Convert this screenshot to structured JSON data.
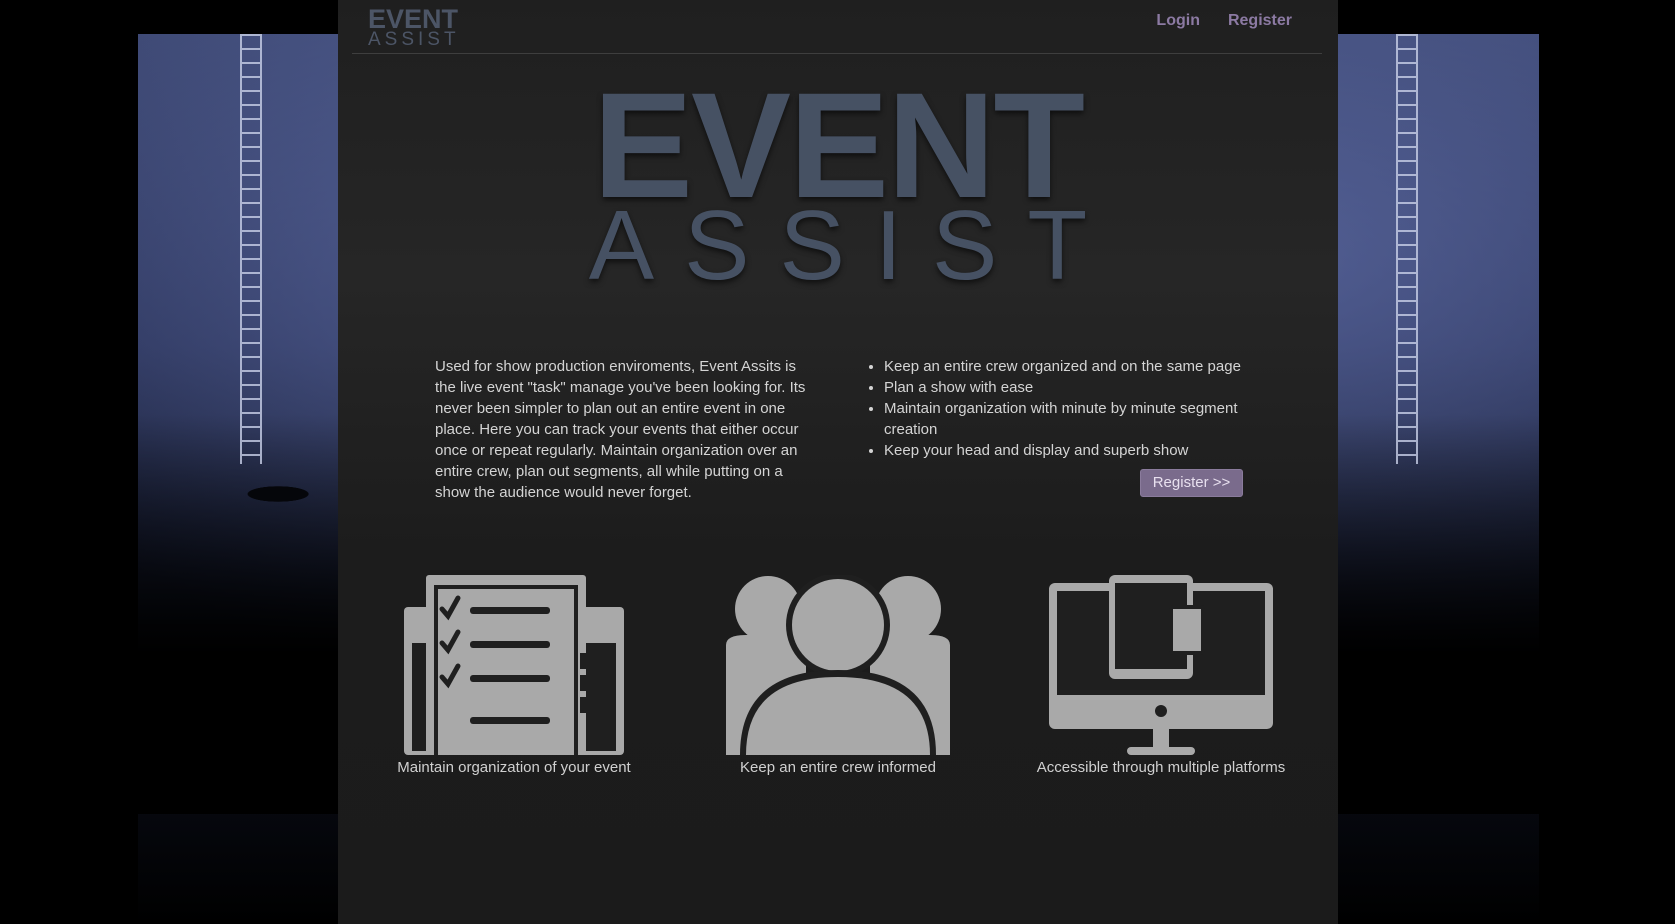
{
  "nav": {
    "logo_top": "EVENT",
    "logo_bottom": "ASSIST",
    "login": "Login",
    "register": "Register"
  },
  "hero": {
    "line1": "EVENT",
    "line2": "ASSIST"
  },
  "intro": {
    "description": "Used for show production enviroments, Event Assits is the live event \"task\" manage you've been looking for. Its never been simpler to plan out an entire event in one place. Here you can track your events that either occur once or repeat regularly. Maintain organization over an entire crew, plan out segments, all while putting on a show the audience would never forget.",
    "features": [
      "Keep an entire crew organized and on the same page",
      "Plan a show with ease",
      "Maintain organization with minute by minute segment creation",
      "Keep your head and display and superb show"
    ],
    "register_button": "Register >>"
  },
  "cards": [
    {
      "icon": "checklist-icon",
      "caption": "Maintain organization of your event"
    },
    {
      "icon": "group-icon",
      "caption": "Keep an entire crew informed"
    },
    {
      "icon": "devices-icon",
      "caption": "Accessible through multiple platforms"
    }
  ],
  "colors": {
    "accent": "#7a6b8c",
    "nav_link": "#8c7aa3",
    "logo": "#465163",
    "panel": "#1f1f1f",
    "icon": "#a9a9a9"
  }
}
